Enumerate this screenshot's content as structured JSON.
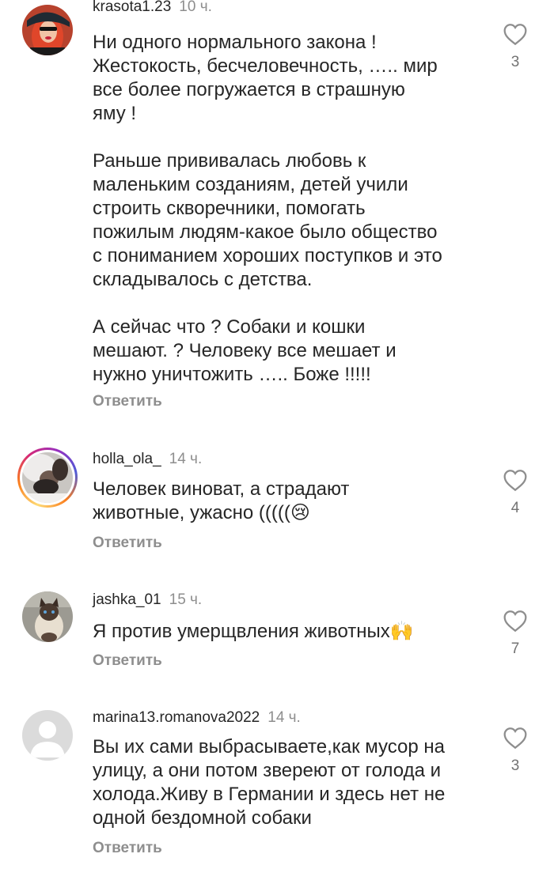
{
  "comments": [
    {
      "username": "krasota1.23",
      "time": "10 ч.",
      "text": "Ни одного нормального закона !\nЖестокость, бесчеловечность, ….. мир\nвсе более погружается в страшную\nяму !\n\nРаньше прививалась любовь к\nмаленьким созданиям, детей учили\nстроить скворечники, помогать\nпожилым людям-какое было общество\nс пониманием хороших поступков и это\nскладывалось с детства.\n\nА сейчас что ? Собаки и кошки\nмешают. ? Человеку все мешает и\nнужно уничтожить ….. Боже !!!!!",
      "reply": "Ответить",
      "likes": "3",
      "avatar": "avatar-red-hair-woman"
    },
    {
      "username": "holla_ola_",
      "time": "14 ч.",
      "text": "Человек виноват, а страдают\nживотные, ужасно (((((😢",
      "reply": "Ответить",
      "likes": "4",
      "avatar": "avatar-woman-with-story-ring"
    },
    {
      "username": "jashka_01",
      "time": "15 ч.",
      "text": "Я против умерщвления животных🙌",
      "reply": "Ответить",
      "likes": "7",
      "avatar": "avatar-siamese-cat"
    },
    {
      "username": "marina13.romanova2022",
      "time": "14 ч.",
      "text": "Вы их сами выбрасываете,как мусор на\nулицу, а они потом звереют от голода и\nхолода.Живу в Германии и здесь нет не\nодной бездомной собаки",
      "reply": "Ответить",
      "likes": "3",
      "avatar": "default-avatar-icon"
    }
  ],
  "colors": {
    "text": "#262626",
    "secondary": "#8e8e8e",
    "heart": "#8e8e8e"
  }
}
